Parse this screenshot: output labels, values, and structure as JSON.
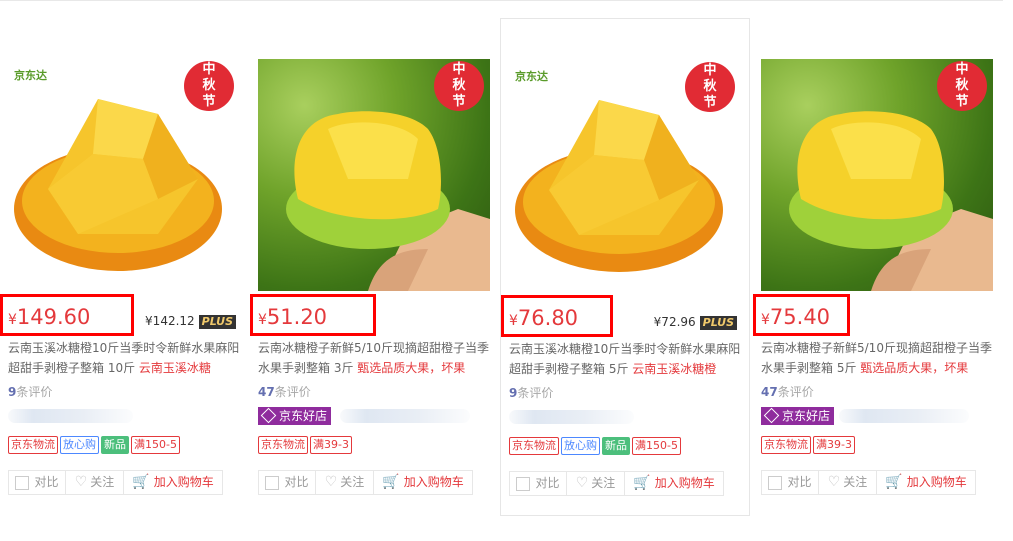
{
  "colors": {
    "price_red": "#e4393c",
    "highlight_box": "#ff0000",
    "jd_purple": "#8f2c9d",
    "plus_dark": "#333333",
    "plus_gold": "#f0c96b"
  },
  "festival_badge": [
    "中",
    "秋",
    "节"
  ],
  "brand_badge": "京东达",
  "products": [
    {
      "image": "orange-cut-white-bg",
      "price_symbol": "¥",
      "price": "149.60",
      "plus_price": "¥142.12",
      "plus_label": "PLUS",
      "title": "云南玉溪冰糖橙10斤当季时令新鲜水果麻阳超甜手剥橙子整箱 10斤",
      "title_promo": "云南玉溪冰糖",
      "review_count": "9",
      "review_suffix": "条评价",
      "shop_badge": "",
      "tags": [
        {
          "text": "京东物流",
          "style": "red"
        },
        {
          "text": "放心购",
          "style": "blue"
        },
        {
          "text": "新品",
          "style": "green"
        },
        {
          "text": "满150-5",
          "style": "red"
        }
      ],
      "actions": {
        "compare": "对比",
        "follow": "关注",
        "cart": "加入购物车"
      }
    },
    {
      "image": "orange-in-hand-green-bg",
      "price_symbol": "¥",
      "price": "51.20",
      "plus_price": "",
      "plus_label": "",
      "title": "云南冰糖橙子新鲜5/10斤现摘超甜橙子当季水果手剥整箱 3斤",
      "title_promo": "甄选品质大果，坏果",
      "review_count": "47",
      "review_suffix": "条评价",
      "shop_badge": "京东好店",
      "tags": [
        {
          "text": "京东物流",
          "style": "red"
        },
        {
          "text": "满39-3",
          "style": "red"
        }
      ],
      "actions": {
        "compare": "对比",
        "follow": "关注",
        "cart": "加入购物车"
      }
    },
    {
      "image": "orange-cut-white-bg",
      "price_symbol": "¥",
      "price": "76.80",
      "plus_price": "¥72.96",
      "plus_label": "PLUS",
      "title": "云南玉溪冰糖橙10斤当季时令新鲜水果麻阳超甜手剥橙子整箱 5斤",
      "title_promo": "云南玉溪冰糖橙",
      "review_count": "9",
      "review_suffix": "条评价",
      "shop_badge": "",
      "tags": [
        {
          "text": "京东物流",
          "style": "red"
        },
        {
          "text": "放心购",
          "style": "blue"
        },
        {
          "text": "新品",
          "style": "green"
        },
        {
          "text": "满150-5",
          "style": "red"
        }
      ],
      "actions": {
        "compare": "对比",
        "follow": "关注",
        "cart": "加入购物车"
      }
    },
    {
      "image": "orange-in-hand-green-bg",
      "price_symbol": "¥",
      "price": "75.40",
      "plus_price": "",
      "plus_label": "",
      "title": "云南冰糖橙子新鲜5/10斤现摘超甜橙子当季水果手剥整箱 5斤",
      "title_promo": "甄选品质大果，坏果",
      "review_count": "47",
      "review_suffix": "条评价",
      "shop_badge": "京东好店",
      "tags": [
        {
          "text": "京东物流",
          "style": "red"
        },
        {
          "text": "满39-3",
          "style": "red"
        }
      ],
      "actions": {
        "compare": "对比",
        "follow": "关注",
        "cart": "加入购物车"
      }
    }
  ]
}
